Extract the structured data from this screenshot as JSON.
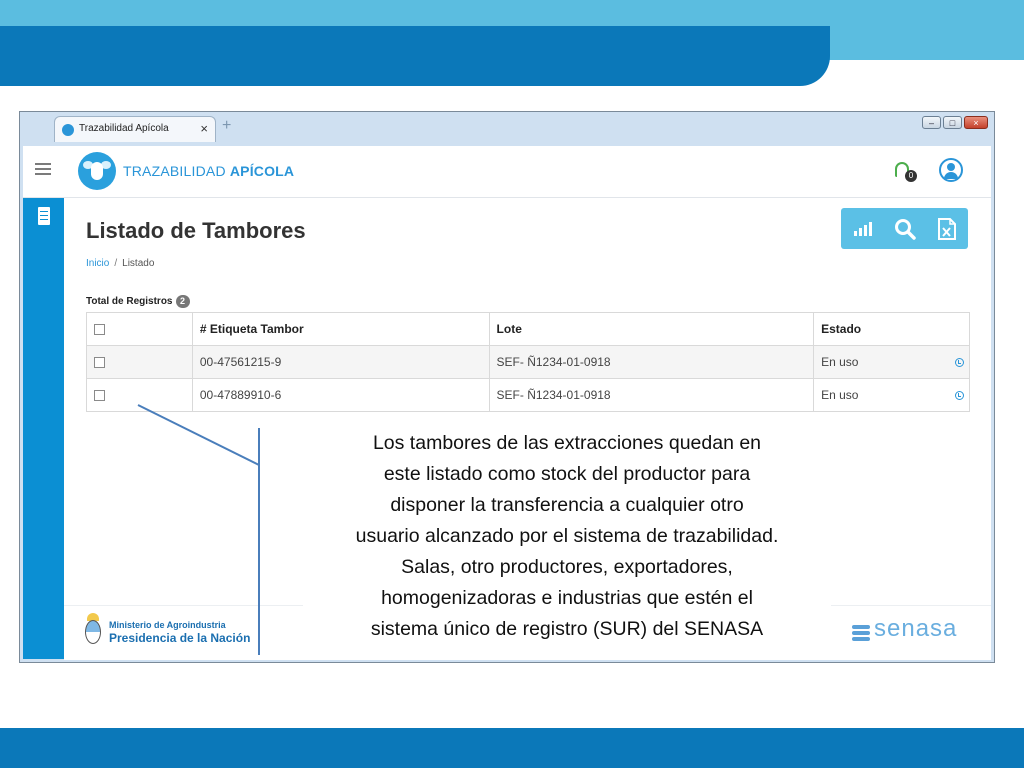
{
  "browser": {
    "tab_title": "Trazabilidad Apícola",
    "tab_close": "×",
    "new_tab": "+",
    "window_buttons": {
      "minimize": "–",
      "maximize": "□",
      "close": "×"
    }
  },
  "app": {
    "brand_light": "TRAZABILIDAD ",
    "brand_bold": "APÍCOLA",
    "notification_count": "0",
    "icons": {
      "menu": "hamburger-icon",
      "logo": "bee-logo",
      "notifications": "bell-icon",
      "user": "user-icon",
      "sidebar": "document-icon",
      "stats": "bar-chart-icon",
      "search": "search-icon",
      "export": "excel-icon",
      "row_action": "clock-icon"
    },
    "colors": {
      "primary": "#2a95d8",
      "sidebar": "#0b8fd3",
      "toolbar": "#5bc0e6",
      "notification": "#4cae4c"
    }
  },
  "page": {
    "title": "Listado de Tambores",
    "breadcrumb": {
      "home": "Inicio",
      "separator": "/",
      "current": "Listado"
    },
    "total_label": "Total de Registros",
    "total_count": "2"
  },
  "table": {
    "headers": {
      "etiqueta": "# Etiqueta Tambor",
      "lote": "Lote",
      "estado": "Estado"
    },
    "rows": [
      {
        "etiqueta": "00-47561215-9",
        "lote": "SEF- Ñ1234-01-0918",
        "estado": "En uso"
      },
      {
        "etiqueta": "00-47889910-6",
        "lote": "SEF- Ñ1234-01-0918",
        "estado": "En uso"
      }
    ]
  },
  "footer": {
    "ministry_line1": "Ministerio de Agroindustria",
    "ministry_line2": "Presidencia de la Nación",
    "senasa_logo": "senasa"
  },
  "annotation": {
    "text": "Los tambores de las extracciones quedan en\neste listado como stock del productor para\ndisponer la transferencia a cualquier otro\nusuario alcanzado por el sistema de trazabilidad.\nSalas, otro productores, exportadores,\nhomogenizadoras e industrias que estén el\nsistema único de registro (SUR) del SENASA"
  },
  "slide": {
    "colors": {
      "band_light": "#5bbde0",
      "band_dark": "#0b78b9"
    }
  }
}
